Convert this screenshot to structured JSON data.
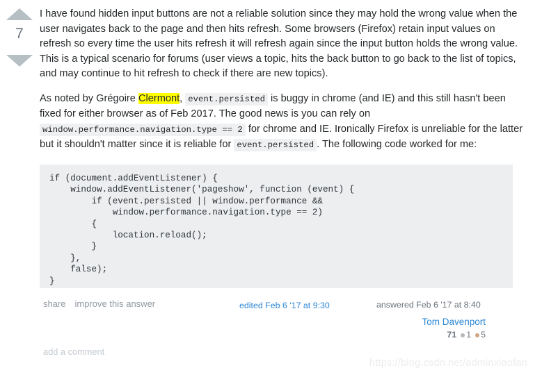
{
  "vote": {
    "up_icon": "triangle-up-icon",
    "down_icon": "triangle-down-icon",
    "count": "7"
  },
  "post": {
    "paragraph1": "I have found hidden input buttons are not a reliable solution since they may hold the wrong value when the user navigates back to the page and then hits refresh. Some browsers (Firefox) retain input values on refresh so every time the user hits refresh it will refresh again since the input button holds the wrong value. This is a typical scenario for forums (user views a topic, hits the back button to go back to the list of topics, and may continue to hit refresh to check if there are new topics).",
    "p2_part1": "As noted by Grégoire ",
    "p2_highlight": "Clermont",
    "p2_part2": ", ",
    "p2_code1": "event.persisted",
    "p2_part3": " is buggy in chrome (and IE) and this still hasn't been fixed for either browser as of Feb 2017. The good news is you can rely on ",
    "p2_code2": "window.performance.navigation.type == 2",
    "p2_part4": " for chrome and IE. Ironically Firefox is unreliable for the latter but it shouldn't matter since it is reliable for ",
    "p2_code3": "event.persisted",
    "p2_part5": ". The following code worked for me:",
    "code_block": "if (document.addEventListener) {\n    window.addEventListener('pageshow', function (event) {\n        if (event.persisted || window.performance &&\n            window.performance.navigation.type == 2)\n        {\n            location.reload();\n        }\n    },\n    false);\n}"
  },
  "post_menu": {
    "share": "share",
    "improve": "improve this answer"
  },
  "edited": {
    "text": "edited Feb 6 '17 at 9:30"
  },
  "answered": {
    "time_text": "answered Feb 6 '17 at 8:40",
    "user_name": "Tom Davenport",
    "reputation": "71",
    "silver_badge_count": "1",
    "bronze_badge_count": "5"
  },
  "comments": {
    "add_comment": "add a comment"
  },
  "watermark": {
    "text": "https://blog.csdn.net/adminxiaofan"
  },
  "colors": {
    "link": "#2d86d6",
    "muted": "#6a737c",
    "code_bg": "#eceef0",
    "inline_code_bg": "#eff0f1",
    "highlight": "#ffff00",
    "arrow": "#b6bfc4",
    "silver_badge": "#b4b8bc",
    "bronze_badge": "#d1a684"
  }
}
